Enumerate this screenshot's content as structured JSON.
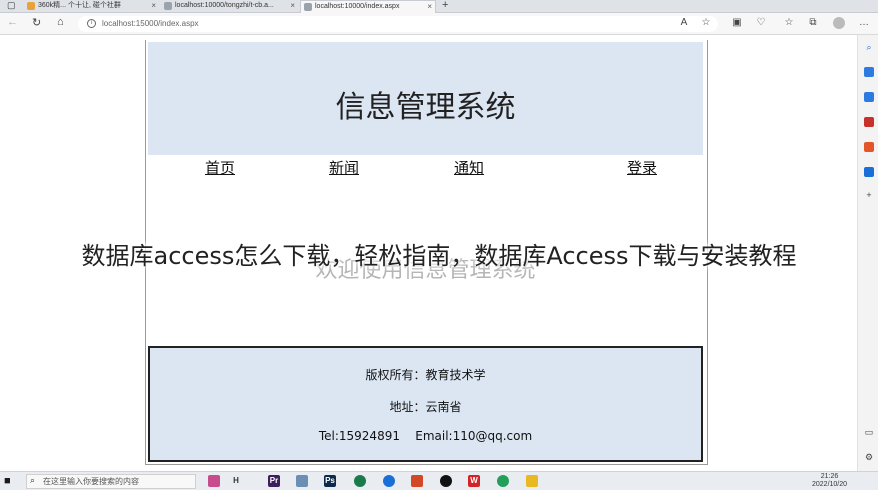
{
  "browser": {
    "tabs": [
      {
        "label": "360k精... 个十让, 碰个社群"
      },
      {
        "label": "localhost:10000/tongzhi/t-cb.a..."
      },
      {
        "label": "localhost:10000/index.aspx"
      }
    ],
    "new_tab_symbol": "+",
    "url": "localhost:15000/index.aspx"
  },
  "page": {
    "title": "信息管理系统",
    "nav": [
      {
        "label": "首页"
      },
      {
        "label": "新闻"
      },
      {
        "label": "通知"
      },
      {
        "label": "登录"
      }
    ],
    "welcome": "欢迎使用信息管理系统",
    "footer": {
      "copyright": "版权所有：教育技术学",
      "address": "地址：云南省",
      "contact": "Tel:15924891    Email:110@qq.com"
    }
  },
  "overlay": {
    "caption": "数据库access怎么下载，轻松指南，数据库Access下载与安装教程"
  },
  "taskbar": {
    "search_placeholder": "在这里输入你要搜索的内容",
    "time": "21:26",
    "date": "2022/10/20"
  },
  "colors": {
    "header_bg": "#dce6f3",
    "footer_bg": "#dce6f3",
    "welcome_text": "#b5b5b5"
  }
}
